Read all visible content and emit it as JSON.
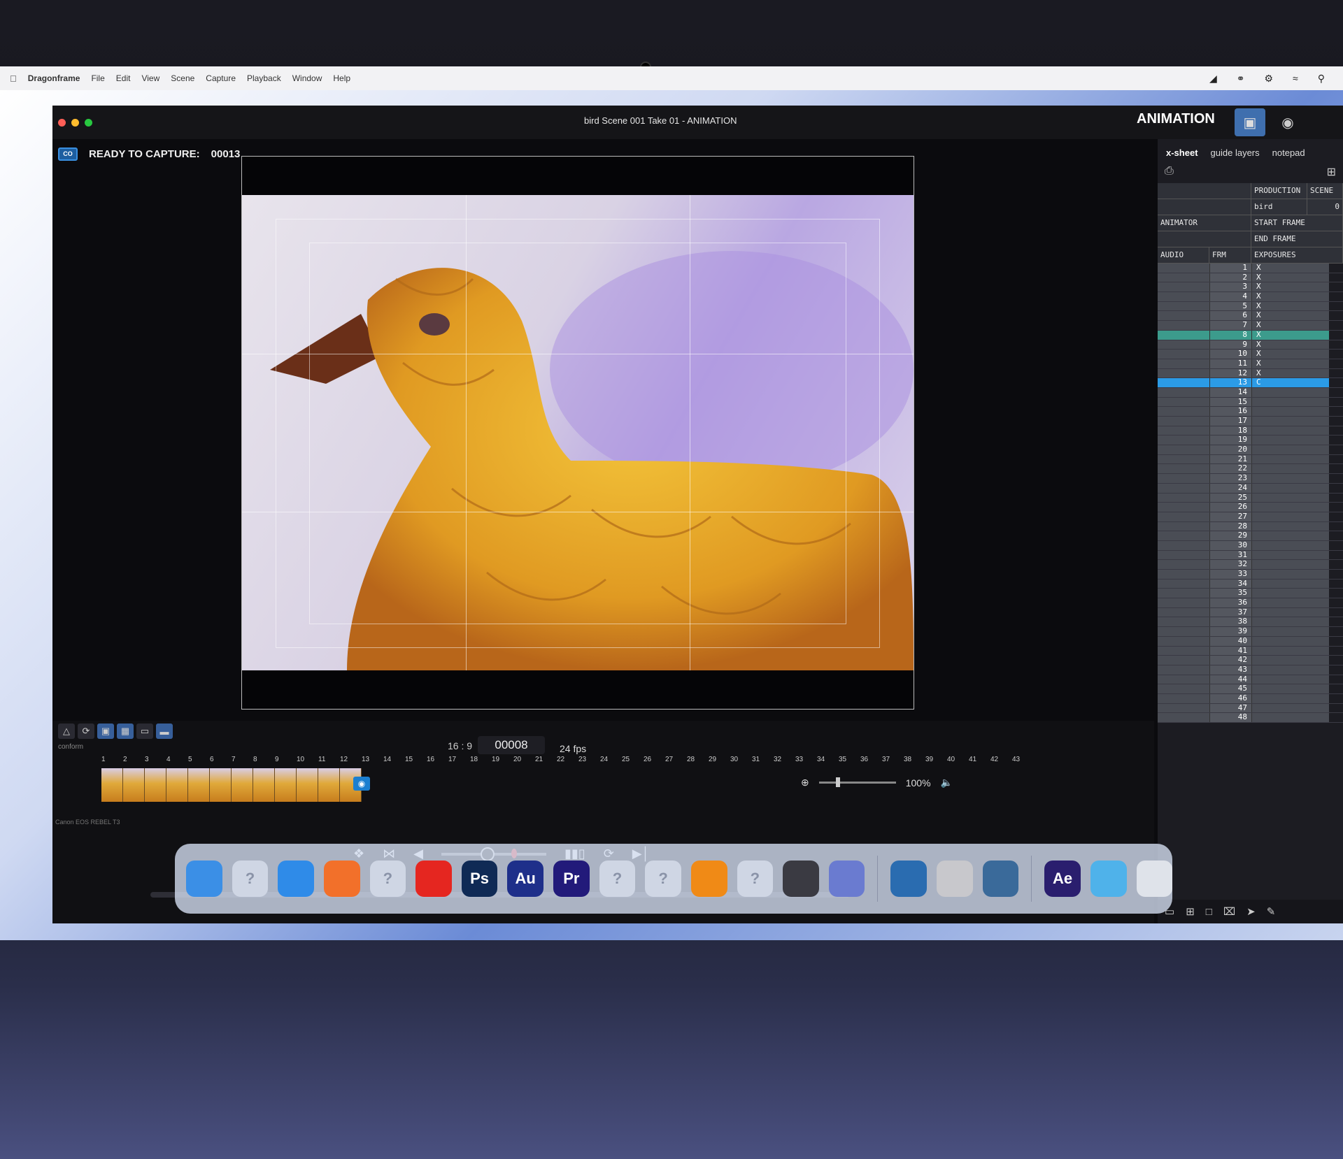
{
  "menubar": {
    "app_name": "Dragonframe",
    "items": [
      "File",
      "Edit",
      "View",
      "Scene",
      "Capture",
      "Playback",
      "Window",
      "Help"
    ]
  },
  "window": {
    "title": "bird  Scene 001  Take 01 - ANIMATION",
    "mode": "ANIMATION"
  },
  "status": {
    "label": "READY TO CAPTURE:",
    "frame": "00013"
  },
  "timeline": {
    "conform_label": "conform",
    "aspect": "16 : 9",
    "current_frame": "00008",
    "fps": "24 fps",
    "zoom": "100%",
    "camera_name": "Canon EOS REBEL T3",
    "ticks": [
      "1",
      "2",
      "3",
      "4",
      "5",
      "6",
      "7",
      "8",
      "9",
      "10",
      "11",
      "12",
      "13",
      "14",
      "15",
      "16",
      "17",
      "18",
      "19",
      "20",
      "21",
      "22",
      "23",
      "24",
      "25",
      "26",
      "27",
      "28",
      "29",
      "30",
      "31",
      "32",
      "33",
      "34",
      "35",
      "36",
      "37",
      "38",
      "39",
      "40",
      "41",
      "42",
      "43"
    ],
    "captured_frames": 12
  },
  "xsheet": {
    "tabs": [
      "x-sheet",
      "guide layers",
      "notepad"
    ],
    "headers": {
      "production": "PRODUCTION",
      "scene": "SCENE",
      "production_value": "bird",
      "scene_value": "0",
      "animator": "ANIMATOR",
      "start_frame": "START FRAME",
      "end_frame": "END FRAME",
      "audio": "AUDIO",
      "frm": "FRM",
      "exposures": "EXPOSURES"
    },
    "rows": [
      {
        "n": "1",
        "x": "X"
      },
      {
        "n": "2",
        "x": "X"
      },
      {
        "n": "3",
        "x": "X"
      },
      {
        "n": "4",
        "x": "X"
      },
      {
        "n": "5",
        "x": "X"
      },
      {
        "n": "6",
        "x": "X"
      },
      {
        "n": "7",
        "x": "X"
      },
      {
        "n": "8",
        "x": "X"
      },
      {
        "n": "9",
        "x": "X"
      },
      {
        "n": "10",
        "x": "X"
      },
      {
        "n": "11",
        "x": "X"
      },
      {
        "n": "12",
        "x": "X"
      },
      {
        "n": "13",
        "x": "C"
      },
      {
        "n": "14",
        "x": ""
      },
      {
        "n": "15",
        "x": ""
      },
      {
        "n": "16",
        "x": ""
      },
      {
        "n": "17",
        "x": ""
      },
      {
        "n": "18",
        "x": ""
      },
      {
        "n": "19",
        "x": ""
      },
      {
        "n": "20",
        "x": ""
      },
      {
        "n": "21",
        "x": ""
      },
      {
        "n": "22",
        "x": ""
      },
      {
        "n": "23",
        "x": ""
      },
      {
        "n": "24",
        "x": ""
      },
      {
        "n": "25",
        "x": ""
      },
      {
        "n": "26",
        "x": ""
      },
      {
        "n": "27",
        "x": ""
      },
      {
        "n": "28",
        "x": ""
      },
      {
        "n": "29",
        "x": ""
      },
      {
        "n": "30",
        "x": ""
      },
      {
        "n": "31",
        "x": ""
      },
      {
        "n": "32",
        "x": ""
      },
      {
        "n": "33",
        "x": ""
      },
      {
        "n": "34",
        "x": ""
      },
      {
        "n": "35",
        "x": ""
      },
      {
        "n": "36",
        "x": ""
      },
      {
        "n": "37",
        "x": ""
      },
      {
        "n": "38",
        "x": ""
      },
      {
        "n": "39",
        "x": ""
      },
      {
        "n": "40",
        "x": ""
      },
      {
        "n": "41",
        "x": ""
      },
      {
        "n": "42",
        "x": ""
      },
      {
        "n": "43",
        "x": ""
      },
      {
        "n": "44",
        "x": ""
      },
      {
        "n": "45",
        "x": ""
      },
      {
        "n": "46",
        "x": ""
      },
      {
        "n": "47",
        "x": ""
      },
      {
        "n": "48",
        "x": ""
      }
    ],
    "highlight_row": "8",
    "current_row": "13"
  },
  "dock": {
    "apps": [
      {
        "name": "finder-icon",
        "label": "",
        "color": "#3b8fe6"
      },
      {
        "name": "unknown-app-icon",
        "label": "?",
        "color": "#cfd6e4"
      },
      {
        "name": "safari-icon",
        "label": "",
        "color": "#2f8be8"
      },
      {
        "name": "firefox-icon",
        "label": "",
        "color": "#f2702a"
      },
      {
        "name": "unknown-app-icon",
        "label": "?",
        "color": "#cfd6e4"
      },
      {
        "name": "acrobat-icon",
        "label": "",
        "color": "#e52620"
      },
      {
        "name": "photoshop-icon",
        "label": "Ps",
        "color": "#0f2a55"
      },
      {
        "name": "audition-icon",
        "label": "Au",
        "color": "#1e2f8a"
      },
      {
        "name": "premiere-icon",
        "label": "Pr",
        "color": "#221a7a"
      },
      {
        "name": "unknown-app-icon",
        "label": "?",
        "color": "#cfd6e4"
      },
      {
        "name": "unknown-app-icon",
        "label": "?",
        "color": "#cfd6e4"
      },
      {
        "name": "vlc-icon",
        "label": "",
        "color": "#f08a16"
      },
      {
        "name": "unknown-app-icon",
        "label": "?",
        "color": "#cfd6e4"
      },
      {
        "name": "final-cut-icon",
        "label": "",
        "color": "#3a3a42"
      },
      {
        "name": "compressor-icon",
        "label": "",
        "color": "#6a7bd0"
      },
      {
        "name": "dragonframe-icon",
        "label": "",
        "color": "#2a6cb0"
      },
      {
        "name": "calculator-icon",
        "label": "",
        "color": "#c8c8cc"
      },
      {
        "name": "quicktime-icon",
        "label": "",
        "color": "#3a6a9a"
      },
      {
        "name": "after-effects-icon",
        "label": "Ae",
        "color": "#2a1e6e"
      },
      {
        "name": "downloads-folder-icon",
        "label": "",
        "color": "#4fb2ea"
      },
      {
        "name": "trash-icon",
        "label": "",
        "color": "#dfe3ea"
      }
    ]
  },
  "colors": {
    "accent": "#2b9be6",
    "highlight": "#3c9b8c",
    "app_bg": "#0b0b0e"
  }
}
